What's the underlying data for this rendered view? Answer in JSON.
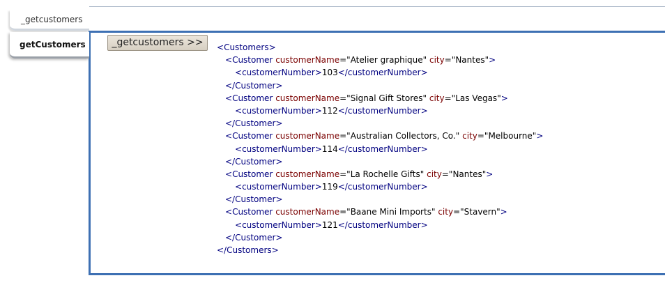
{
  "tabs": [
    {
      "label": "_getcustomers",
      "active": false
    },
    {
      "label": "getCustomers",
      "active": true
    }
  ],
  "run_button": {
    "label": "_getcustomers >>"
  },
  "xml": {
    "root_tag": "Customers",
    "record_tag": "Customer",
    "name_attr": "customerName",
    "city_attr": "city",
    "number_tag": "customerNumber",
    "customers": [
      {
        "name": "Atelier graphique",
        "city": "Nantes",
        "number": "103"
      },
      {
        "name": "Signal Gift Stores",
        "city": "Las Vegas",
        "number": "112"
      },
      {
        "name": "Australian Collectors, Co.",
        "city": "Melbourne",
        "number": "114"
      },
      {
        "name": "La Rochelle Gifts",
        "city": "Nantes",
        "number": "119"
      },
      {
        "name": "Baane Mini Imports",
        "city": "Stavern",
        "number": "121"
      }
    ]
  },
  "colors": {
    "panel_border": "#3d70b3",
    "xml_tag": "#000080",
    "xml_attr": "#7a0000"
  }
}
